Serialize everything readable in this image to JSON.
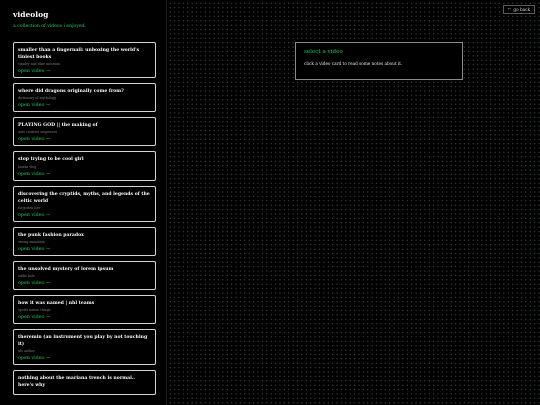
{
  "site": {
    "title": "videolog",
    "subtitle": "a collection of videos i enjoyed."
  },
  "cards": [
    {
      "title": "smaller than a fingernail: unboxing the world's tiniest books",
      "author": "stanley and elise museum",
      "link": "open video →"
    },
    {
      "title": "where did dragons originally come from?",
      "author": "dictionary of mythology",
      "link": "open video →"
    },
    {
      "title": "PLAYING GOD || the making of",
      "author": "auto creative sequences",
      "link": "open video →"
    },
    {
      "title": "stop trying to be cool girl",
      "author": "laurka vlog",
      "link": "open video →"
    },
    {
      "title": "discovering the cryptids, myths, and legends of the celtic world",
      "author": "forgotten lore",
      "link": "open video →"
    },
    {
      "title": "the punk fashion paradox",
      "author": "strong mountain",
      "link": "open video →"
    },
    {
      "title": "the unsolved mystery of lorem ipsum",
      "author": "addie kole",
      "link": "open video →"
    },
    {
      "title": "how it was named | nhl teams",
      "author": "sports nation things",
      "link": "open video →"
    },
    {
      "title": "theremin (an instrument you play by not touching it)",
      "author": "tdc author",
      "link": "open video →"
    },
    {
      "title": "nothing about the mariana trench is normal.. here's why",
      "author": "",
      "link": ""
    }
  ],
  "main": {
    "back_label": "go back",
    "notes_title": "select a video",
    "notes_text": "click a video card to read some notes about it."
  }
}
